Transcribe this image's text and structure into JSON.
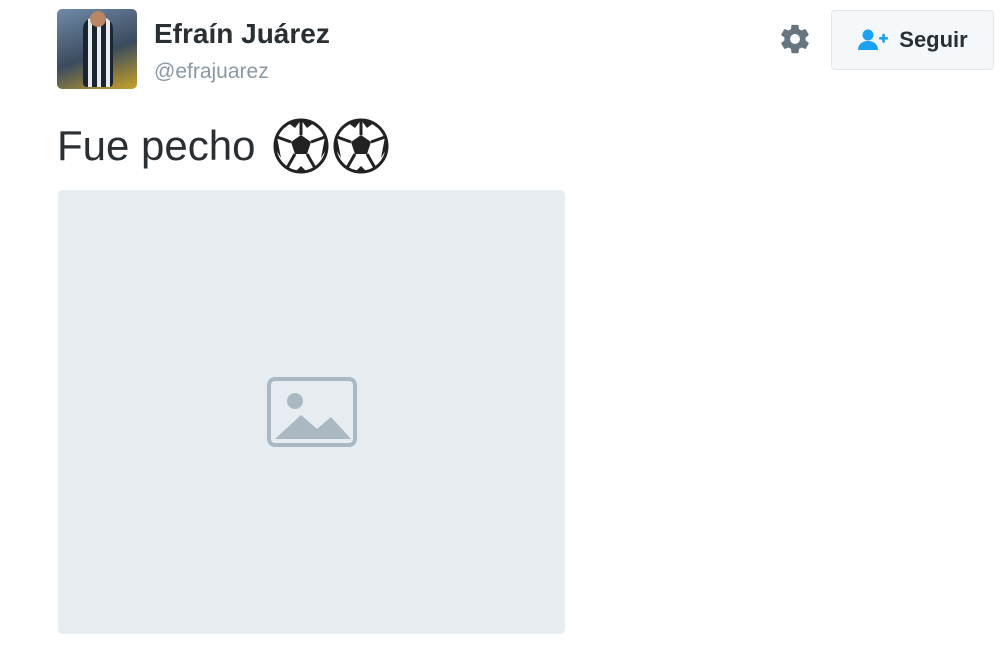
{
  "user": {
    "display_name": "Efraín Juárez",
    "handle": "@efrajuarez"
  },
  "header": {
    "follow_label": "Seguir",
    "settings_icon": "gear-icon",
    "follow_icon": "add-user-icon"
  },
  "tweet": {
    "text": "Fue pecho",
    "emoji": [
      "soccer-ball-icon",
      "soccer-ball-icon"
    ]
  },
  "colors": {
    "accent": "#1da1f2",
    "text": "#292f33",
    "muted": "#8899a6"
  }
}
